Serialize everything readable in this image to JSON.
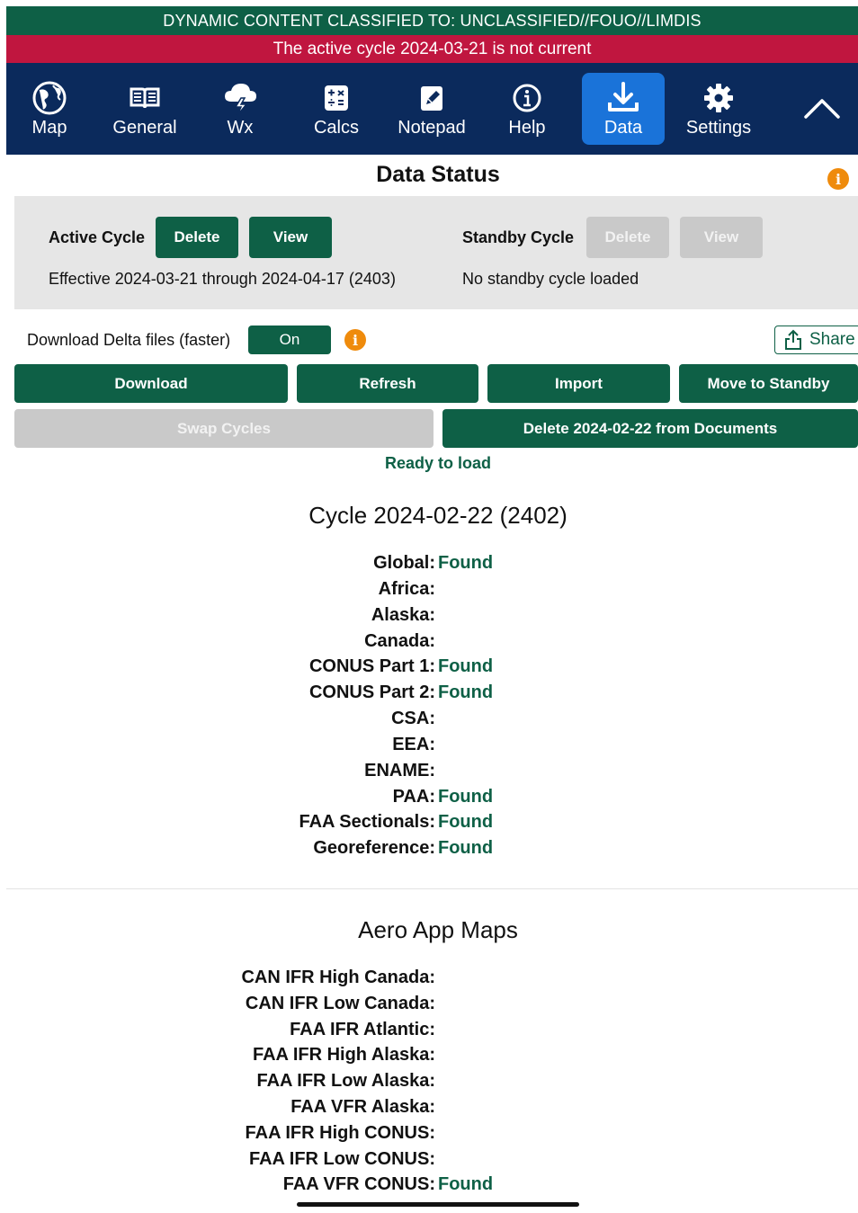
{
  "banners": {
    "classification": "DYNAMIC CONTENT CLASSIFIED TO: UNCLASSIFIED//FOUO//LIMDIS",
    "warning": "The active cycle 2024-03-21 is not current"
  },
  "nav": {
    "items": [
      {
        "label": "Map",
        "icon": "globe-icon"
      },
      {
        "label": "General",
        "icon": "book-icon"
      },
      {
        "label": "Wx",
        "icon": "storm-cloud-icon"
      },
      {
        "label": "Calcs",
        "icon": "calculator-icon"
      },
      {
        "label": "Notepad",
        "icon": "notepad-pencil-icon"
      },
      {
        "label": "Help",
        "icon": "info-circle-icon"
      },
      {
        "label": "Data",
        "icon": "download-icon",
        "active": true
      },
      {
        "label": "Settings",
        "icon": "gear-icon"
      }
    ],
    "collapse_icon": "chevron-up-icon"
  },
  "colors": {
    "primary_green": "#0e6046",
    "classification_bg": "#0e6046",
    "warning_bg": "#c0163f",
    "nav_bg": "#0b2a5c",
    "nav_active": "#1a73d9",
    "info_orange": "#ef8b0c"
  },
  "data_status": {
    "title": "Data Status",
    "active": {
      "label": "Active Cycle",
      "delete": "Delete",
      "view": "View",
      "effective": "Effective 2024-03-21 through 2024-04-17 (2403)"
    },
    "standby": {
      "label": "Standby Cycle",
      "delete": "Delete",
      "view": "View",
      "status": "No standby cycle loaded"
    }
  },
  "delta": {
    "label": "Download Delta files (faster)",
    "toggle": "On",
    "share": "Share"
  },
  "actions": {
    "download": "Download",
    "refresh": "Refresh",
    "import": "Import",
    "move_to_standby": "Move to Standby",
    "swap_cycles": "Swap Cycles",
    "delete_from_documents": "Delete 2024-02-22 from Documents",
    "status": "Ready to load"
  },
  "cycle": {
    "title": "Cycle 2024-02-22 (2402)",
    "rows": [
      {
        "label": "Global:",
        "value": "Found"
      },
      {
        "label": "Africa:",
        "value": ""
      },
      {
        "label": "Alaska:",
        "value": ""
      },
      {
        "label": "Canada:",
        "value": ""
      },
      {
        "label": "CONUS Part 1:",
        "value": "Found"
      },
      {
        "label": "CONUS Part 2:",
        "value": "Found"
      },
      {
        "label": "CSA:",
        "value": ""
      },
      {
        "label": "EEA:",
        "value": ""
      },
      {
        "label": "ENAME:",
        "value": ""
      },
      {
        "label": "PAA:",
        "value": "Found"
      },
      {
        "label": "FAA Sectionals:",
        "value": "Found"
      },
      {
        "label": "Georeference:",
        "value": "Found"
      }
    ]
  },
  "aero": {
    "title": "Aero App Maps",
    "rows": [
      {
        "label": "CAN IFR High Canada:",
        "value": ""
      },
      {
        "label": "CAN IFR Low Canada:",
        "value": ""
      },
      {
        "label": "FAA IFR Atlantic:",
        "value": ""
      },
      {
        "label": "FAA IFR High Alaska:",
        "value": ""
      },
      {
        "label": "FAA IFR Low Alaska:",
        "value": ""
      },
      {
        "label": "FAA VFR Alaska:",
        "value": ""
      },
      {
        "label": "FAA IFR High CONUS:",
        "value": ""
      },
      {
        "label": "FAA IFR Low CONUS:",
        "value": ""
      },
      {
        "label": "FAA VFR CONUS:",
        "value": "Found"
      }
    ]
  }
}
